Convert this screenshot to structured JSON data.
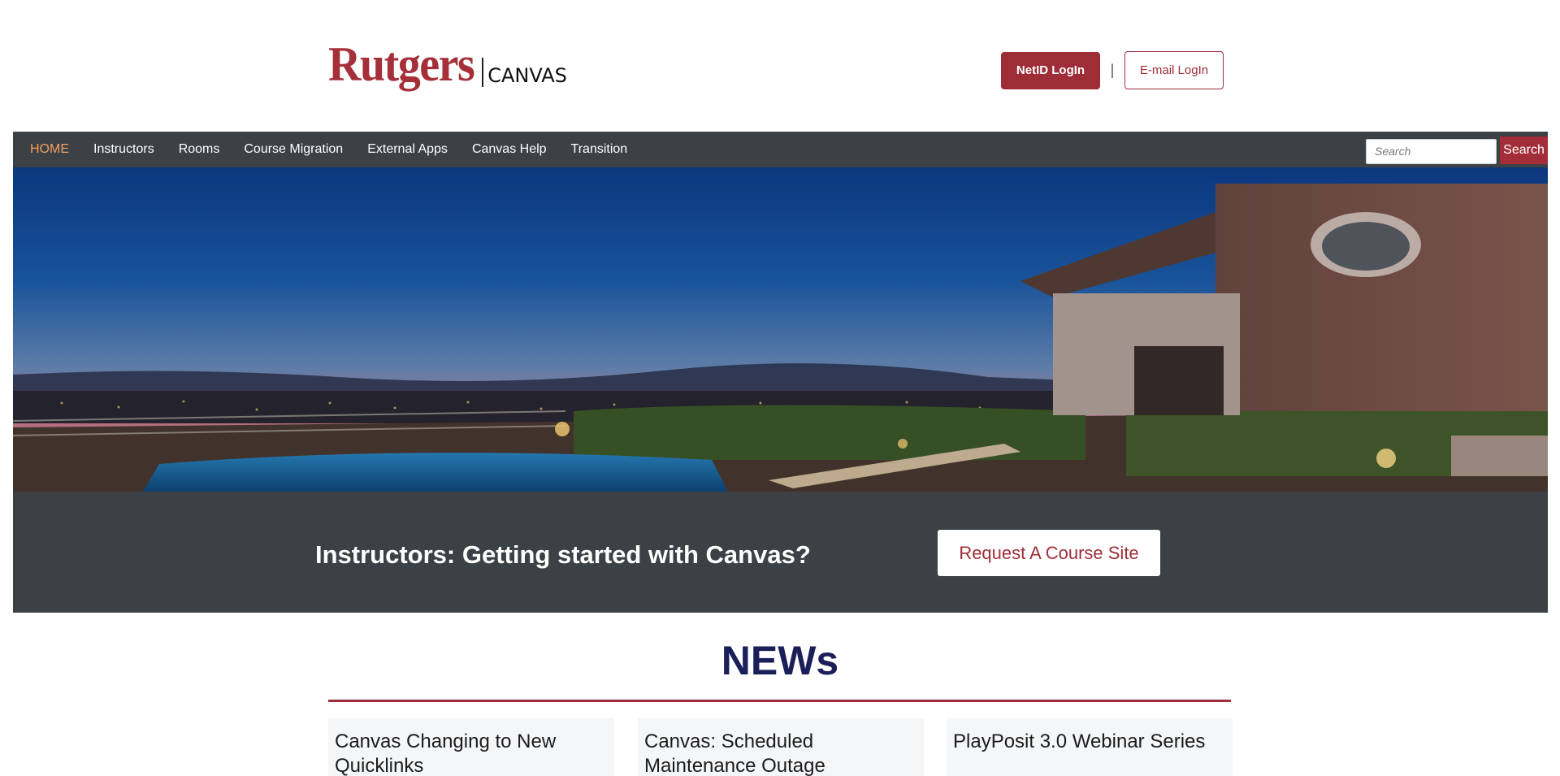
{
  "header": {
    "logo_main": "Rutgers",
    "logo_sub": "CANVAS",
    "netid_login": "NetID LogIn",
    "login_divider": "|",
    "email_login": "E-mail LogIn"
  },
  "nav": {
    "items": [
      {
        "label": "HOME",
        "active": true
      },
      {
        "label": "Instructors"
      },
      {
        "label": "Rooms"
      },
      {
        "label": "Course Migration"
      },
      {
        "label": "External Apps"
      },
      {
        "label": "Canvas Help"
      },
      {
        "label": "Transition"
      }
    ],
    "search_placeholder": "Search",
    "search_button": "Search"
  },
  "cta": {
    "heading": "Instructors: Getting started with Canvas?",
    "button": "Request A Course Site"
  },
  "news": {
    "title": "NEWs",
    "cards": [
      {
        "title": "Canvas Changing to New Quicklinks"
      },
      {
        "title": "Canvas: Scheduled Maintenance Outage"
      },
      {
        "title": "PlayPosit 3.0 Webinar Series"
      }
    ]
  },
  "colors": {
    "brand": "#9e2d38",
    "nav_bg": "#3c4146",
    "news_title": "#1a1f5a",
    "nav_active": "#f0a060"
  }
}
